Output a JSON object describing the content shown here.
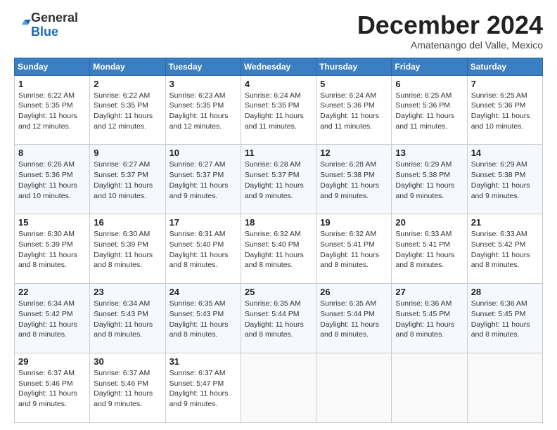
{
  "logo": {
    "line1": "General",
    "line2": "Blue"
  },
  "header": {
    "month": "December 2024",
    "location": "Amatenango del Valle, Mexico"
  },
  "weekdays": [
    "Sunday",
    "Monday",
    "Tuesday",
    "Wednesday",
    "Thursday",
    "Friday",
    "Saturday"
  ],
  "weeks": [
    [
      {
        "day": "1",
        "rise": "6:22 AM",
        "set": "5:35 PM",
        "daylight": "11 hours and 12 minutes."
      },
      {
        "day": "2",
        "rise": "6:22 AM",
        "set": "5:35 PM",
        "daylight": "11 hours and 12 minutes."
      },
      {
        "day": "3",
        "rise": "6:23 AM",
        "set": "5:35 PM",
        "daylight": "11 hours and 12 minutes."
      },
      {
        "day": "4",
        "rise": "6:24 AM",
        "set": "5:35 PM",
        "daylight": "11 hours and 11 minutes."
      },
      {
        "day": "5",
        "rise": "6:24 AM",
        "set": "5:36 PM",
        "daylight": "11 hours and 11 minutes."
      },
      {
        "day": "6",
        "rise": "6:25 AM",
        "set": "5:36 PM",
        "daylight": "11 hours and 11 minutes."
      },
      {
        "day": "7",
        "rise": "6:25 AM",
        "set": "5:36 PM",
        "daylight": "11 hours and 10 minutes."
      }
    ],
    [
      {
        "day": "8",
        "rise": "6:26 AM",
        "set": "5:36 PM",
        "daylight": "11 hours and 10 minutes."
      },
      {
        "day": "9",
        "rise": "6:27 AM",
        "set": "5:37 PM",
        "daylight": "11 hours and 10 minutes."
      },
      {
        "day": "10",
        "rise": "6:27 AM",
        "set": "5:37 PM",
        "daylight": "11 hours and 9 minutes."
      },
      {
        "day": "11",
        "rise": "6:28 AM",
        "set": "5:37 PM",
        "daylight": "11 hours and 9 minutes."
      },
      {
        "day": "12",
        "rise": "6:28 AM",
        "set": "5:38 PM",
        "daylight": "11 hours and 9 minutes."
      },
      {
        "day": "13",
        "rise": "6:29 AM",
        "set": "5:38 PM",
        "daylight": "11 hours and 9 minutes."
      },
      {
        "day": "14",
        "rise": "6:29 AM",
        "set": "5:38 PM",
        "daylight": "11 hours and 9 minutes."
      }
    ],
    [
      {
        "day": "15",
        "rise": "6:30 AM",
        "set": "5:39 PM",
        "daylight": "11 hours and 8 minutes."
      },
      {
        "day": "16",
        "rise": "6:30 AM",
        "set": "5:39 PM",
        "daylight": "11 hours and 8 minutes."
      },
      {
        "day": "17",
        "rise": "6:31 AM",
        "set": "5:40 PM",
        "daylight": "11 hours and 8 minutes."
      },
      {
        "day": "18",
        "rise": "6:32 AM",
        "set": "5:40 PM",
        "daylight": "11 hours and 8 minutes."
      },
      {
        "day": "19",
        "rise": "6:32 AM",
        "set": "5:41 PM",
        "daylight": "11 hours and 8 minutes."
      },
      {
        "day": "20",
        "rise": "6:33 AM",
        "set": "5:41 PM",
        "daylight": "11 hours and 8 minutes."
      },
      {
        "day": "21",
        "rise": "6:33 AM",
        "set": "5:42 PM",
        "daylight": "11 hours and 8 minutes."
      }
    ],
    [
      {
        "day": "22",
        "rise": "6:34 AM",
        "set": "5:42 PM",
        "daylight": "11 hours and 8 minutes."
      },
      {
        "day": "23",
        "rise": "6:34 AM",
        "set": "5:43 PM",
        "daylight": "11 hours and 8 minutes."
      },
      {
        "day": "24",
        "rise": "6:35 AM",
        "set": "5:43 PM",
        "daylight": "11 hours and 8 minutes."
      },
      {
        "day": "25",
        "rise": "6:35 AM",
        "set": "5:44 PM",
        "daylight": "11 hours and 8 minutes."
      },
      {
        "day": "26",
        "rise": "6:35 AM",
        "set": "5:44 PM",
        "daylight": "11 hours and 8 minutes."
      },
      {
        "day": "27",
        "rise": "6:36 AM",
        "set": "5:45 PM",
        "daylight": "11 hours and 8 minutes."
      },
      {
        "day": "28",
        "rise": "6:36 AM",
        "set": "5:45 PM",
        "daylight": "11 hours and 8 minutes."
      }
    ],
    [
      {
        "day": "29",
        "rise": "6:37 AM",
        "set": "5:46 PM",
        "daylight": "11 hours and 9 minutes."
      },
      {
        "day": "30",
        "rise": "6:37 AM",
        "set": "5:46 PM",
        "daylight": "11 hours and 9 minutes."
      },
      {
        "day": "31",
        "rise": "6:37 AM",
        "set": "5:47 PM",
        "daylight": "11 hours and 9 minutes."
      },
      null,
      null,
      null,
      null
    ]
  ],
  "labels": {
    "sunrise": "Sunrise:",
    "sunset": "Sunset:",
    "daylight": "Daylight:"
  }
}
